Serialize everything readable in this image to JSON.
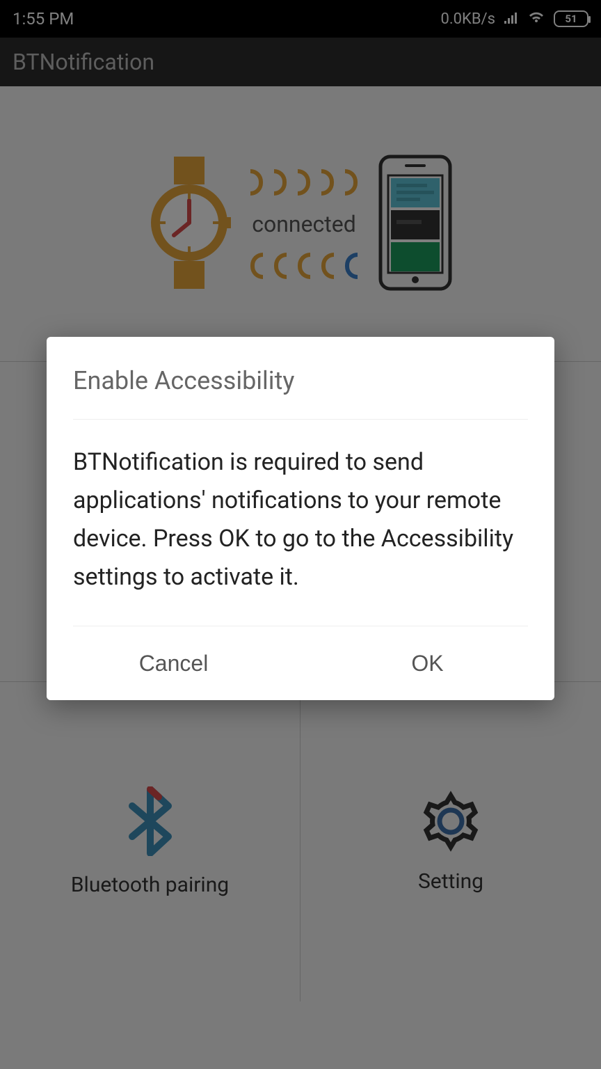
{
  "status_bar": {
    "time": "1:55 PM",
    "data_rate": "0.0KB/s",
    "battery": "51"
  },
  "title_bar": {
    "app_name": "BTNotification"
  },
  "connection": {
    "status_text": "connected"
  },
  "grid": {
    "bluetooth_label": "Bluetooth pairing",
    "setting_label": "Setting"
  },
  "dialog": {
    "title": "Enable Accessibility",
    "body": "BTNotification is required to send applications' notifications to your remote device. Press OK to go to the Accessibility settings to activate it.",
    "cancel_label": "Cancel",
    "ok_label": "OK"
  }
}
